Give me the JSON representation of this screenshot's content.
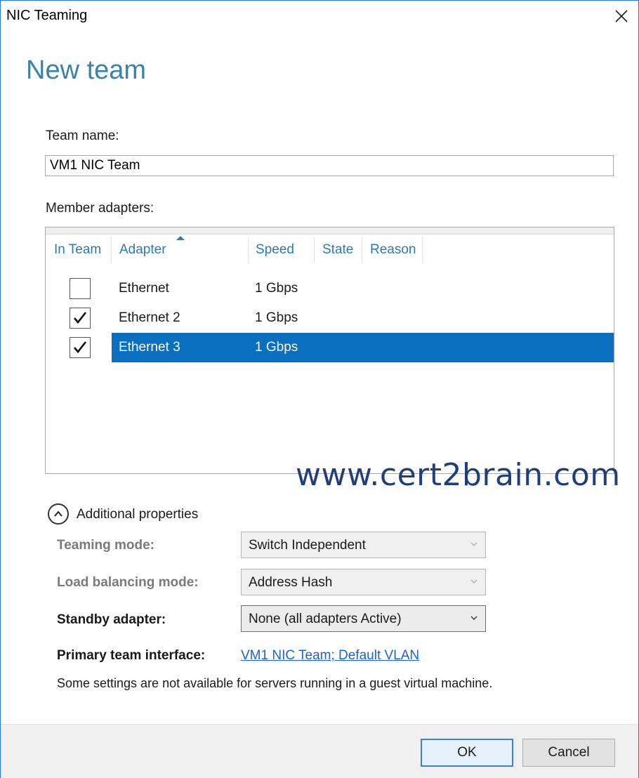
{
  "window": {
    "title": "NIC Teaming",
    "close_icon": "close-icon"
  },
  "page": {
    "heading": "New team"
  },
  "team_name": {
    "label": "Team name:",
    "value": "VM1 NIC Team"
  },
  "member_adapters": {
    "label": "Member adapters:",
    "columns": [
      "In Team",
      "Adapter",
      "Speed",
      "State",
      "Reason"
    ],
    "sorted_by": "Adapter",
    "rows": [
      {
        "in_team": false,
        "adapter": "Ethernet",
        "speed": "1 Gbps",
        "state": "",
        "reason": "",
        "selected": false
      },
      {
        "in_team": true,
        "adapter": "Ethernet 2",
        "speed": "1 Gbps",
        "state": "",
        "reason": "",
        "selected": false
      },
      {
        "in_team": true,
        "adapter": "Ethernet 3",
        "speed": "1 Gbps",
        "state": "",
        "reason": "",
        "selected": true
      }
    ]
  },
  "watermark": "www.cert2brain.com",
  "additional_properties": {
    "toggle_label": "Additional properties",
    "expander_icon": "chevron-up-icon",
    "teaming_mode": {
      "label": "Teaming mode:",
      "value": "Switch Independent",
      "enabled": false
    },
    "load_balancing_mode": {
      "label": "Load balancing mode:",
      "value": "Address Hash",
      "enabled": false
    },
    "standby_adapter": {
      "label": "Standby adapter:",
      "value": "None (all adapters Active)",
      "enabled": true
    },
    "primary_team_interface": {
      "label": "Primary team interface:",
      "link": "VM1 NIC Team; Default VLAN"
    },
    "note": "Some settings are not available for servers running in a guest virtual machine."
  },
  "buttons": {
    "ok": "OK",
    "cancel": "Cancel"
  },
  "colors": {
    "accent": "#0a6fbf",
    "heading": "#3a83a6",
    "link": "#1a66c7",
    "column_header": "#2a7ab8"
  }
}
